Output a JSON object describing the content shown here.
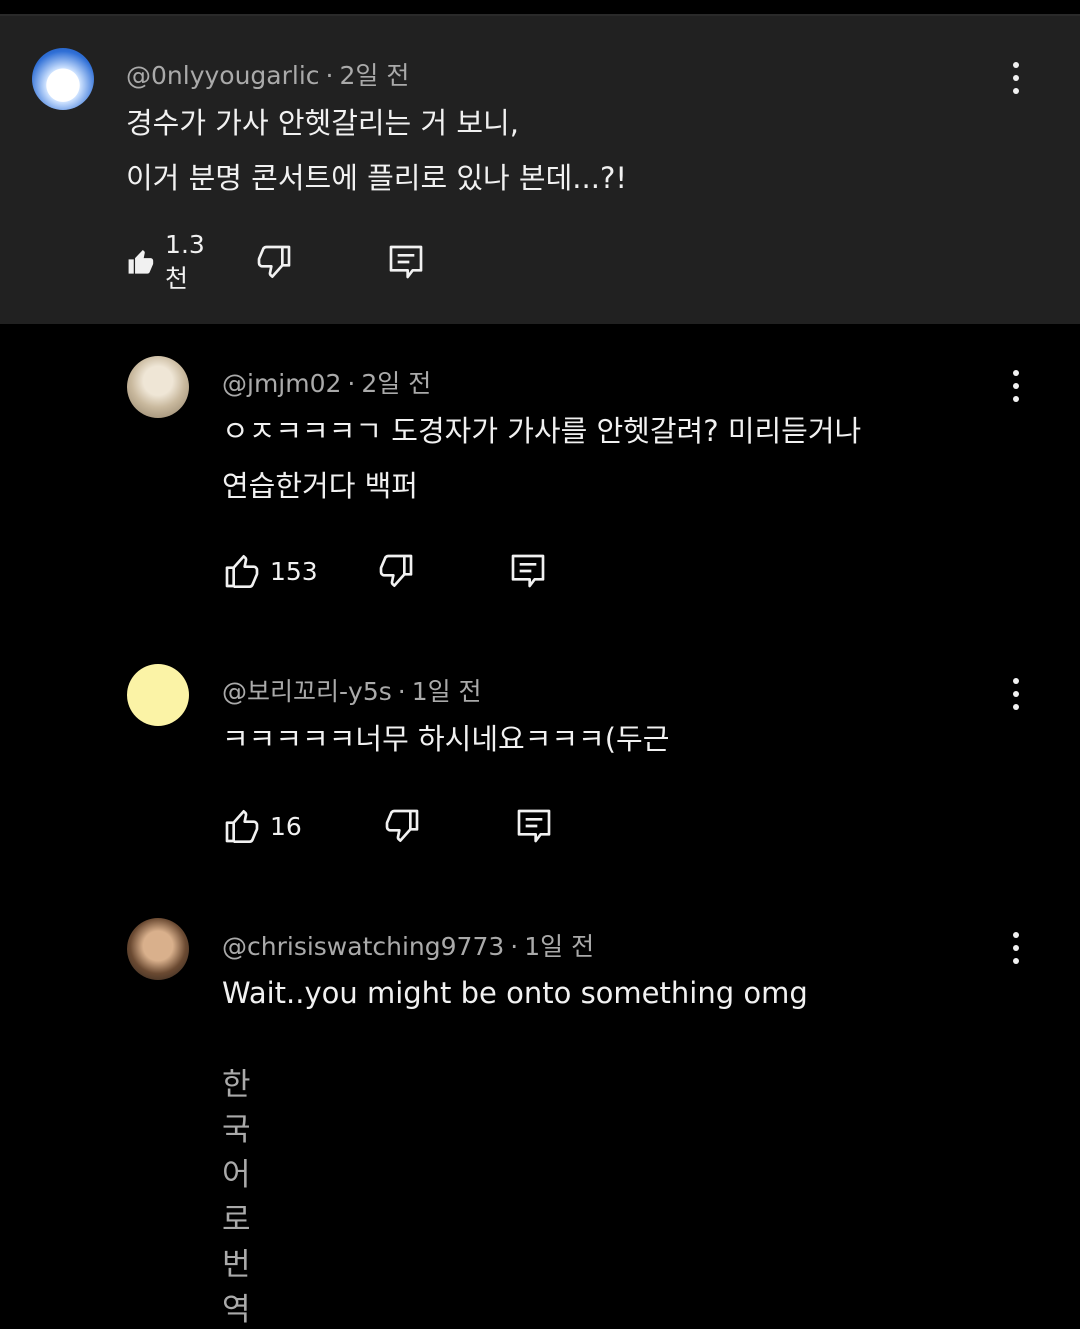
{
  "comments": [
    {
      "handle": "@0nlyyougarlic",
      "time": "2일 전",
      "lines": [
        "경수가 가사 안헷갈리는 거 보니,",
        "이거 분명 콘서트에 플리로 있나 본데...?!"
      ],
      "likes": "1.3천",
      "liked": true,
      "avatar": "cloud-sky-avatar"
    },
    {
      "handle": "@jmjm02",
      "time": "2일 전",
      "lines": [
        "ㅇㅈㅋㅋㅋㄱ 도경자가 가사를 안헷갈려? 미리듣거나",
        "연습한거다 백퍼"
      ],
      "likes": "153",
      "liked": false,
      "avatar": "illustration-avatar"
    },
    {
      "handle": "@보리꼬리-y5s",
      "time": "1일 전",
      "lines": [
        "ㅋㅋㅋㅋㅋ너무 하시네요ㅋㅋㅋ(두근"
      ],
      "likes": "16",
      "liked": false,
      "avatar": "yellow-handwriting-avatar"
    },
    {
      "handle": "@chrisiswatching9773",
      "time": "1일 전",
      "lines": [
        "Wait..you might be onto something omg"
      ],
      "translate": "한국어로 번역",
      "avatar": "person-photo-avatar"
    }
  ],
  "colors": {
    "background": "#000000",
    "parent_background": "#212121",
    "text": "#f1f1f1",
    "meta": "#aaaaaa"
  }
}
